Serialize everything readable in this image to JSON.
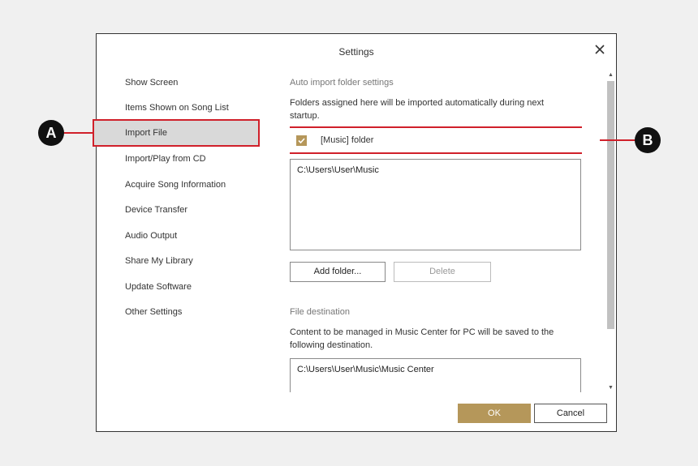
{
  "dialog": {
    "title": "Settings",
    "close_icon": "close-icon"
  },
  "nav": {
    "items": [
      {
        "label": "Show Screen"
      },
      {
        "label": "Items Shown on Song List"
      },
      {
        "label": "Import File",
        "selected": true
      },
      {
        "label": "Import/Play from CD"
      },
      {
        "label": "Acquire Song Information"
      },
      {
        "label": "Device Transfer"
      },
      {
        "label": "Audio Output"
      },
      {
        "label": "Share My Library"
      },
      {
        "label": "Update Software"
      },
      {
        "label": "Other Settings"
      }
    ]
  },
  "auto_import": {
    "title": "Auto import folder settings",
    "description": "Folders assigned here will be imported automatically during next startup.",
    "checkbox_label": "[Music] folder",
    "checked": true,
    "folders": [
      "C:\\Users\\User\\Music"
    ],
    "add_button": "Add folder...",
    "delete_button": "Delete"
  },
  "file_destination": {
    "title": "File destination",
    "description": "Content to be managed in Music Center for PC will be saved to the following destination.",
    "path": "C:\\Users\\User\\Music\\Music Center"
  },
  "footer": {
    "ok": "OK",
    "cancel": "Cancel"
  },
  "callouts": {
    "a": "A",
    "b": "B"
  },
  "colors": {
    "accent": "#b5975a",
    "highlight": "#d0202a"
  }
}
